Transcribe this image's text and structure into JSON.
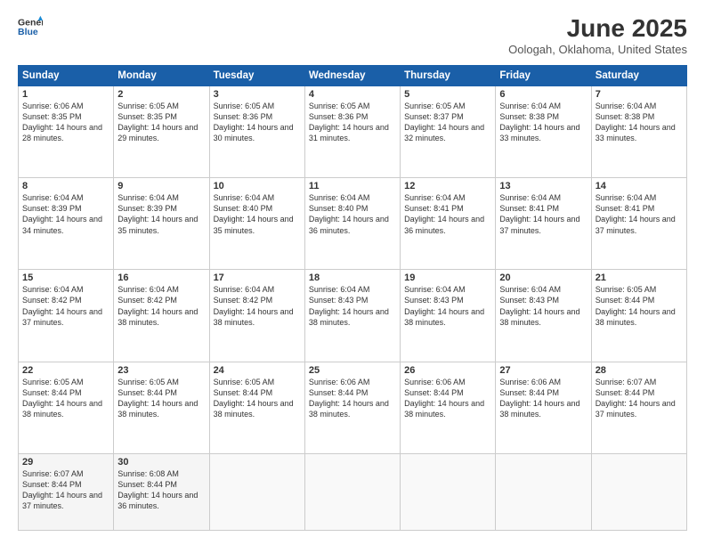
{
  "header": {
    "logo_line1": "General",
    "logo_line2": "Blue",
    "month": "June 2025",
    "location": "Oologah, Oklahoma, United States"
  },
  "days_of_week": [
    "Sunday",
    "Monday",
    "Tuesday",
    "Wednesday",
    "Thursday",
    "Friday",
    "Saturday"
  ],
  "weeks": [
    [
      {
        "day": "1",
        "sunrise": "Sunrise: 6:06 AM",
        "sunset": "Sunset: 8:35 PM",
        "daylight": "Daylight: 14 hours and 28 minutes."
      },
      {
        "day": "2",
        "sunrise": "Sunrise: 6:05 AM",
        "sunset": "Sunset: 8:35 PM",
        "daylight": "Daylight: 14 hours and 29 minutes."
      },
      {
        "day": "3",
        "sunrise": "Sunrise: 6:05 AM",
        "sunset": "Sunset: 8:36 PM",
        "daylight": "Daylight: 14 hours and 30 minutes."
      },
      {
        "day": "4",
        "sunrise": "Sunrise: 6:05 AM",
        "sunset": "Sunset: 8:36 PM",
        "daylight": "Daylight: 14 hours and 31 minutes."
      },
      {
        "day": "5",
        "sunrise": "Sunrise: 6:05 AM",
        "sunset": "Sunset: 8:37 PM",
        "daylight": "Daylight: 14 hours and 32 minutes."
      },
      {
        "day": "6",
        "sunrise": "Sunrise: 6:04 AM",
        "sunset": "Sunset: 8:38 PM",
        "daylight": "Daylight: 14 hours and 33 minutes."
      },
      {
        "day": "7",
        "sunrise": "Sunrise: 6:04 AM",
        "sunset": "Sunset: 8:38 PM",
        "daylight": "Daylight: 14 hours and 33 minutes."
      }
    ],
    [
      {
        "day": "8",
        "sunrise": "Sunrise: 6:04 AM",
        "sunset": "Sunset: 8:39 PM",
        "daylight": "Daylight: 14 hours and 34 minutes."
      },
      {
        "day": "9",
        "sunrise": "Sunrise: 6:04 AM",
        "sunset": "Sunset: 8:39 PM",
        "daylight": "Daylight: 14 hours and 35 minutes."
      },
      {
        "day": "10",
        "sunrise": "Sunrise: 6:04 AM",
        "sunset": "Sunset: 8:40 PM",
        "daylight": "Daylight: 14 hours and 35 minutes."
      },
      {
        "day": "11",
        "sunrise": "Sunrise: 6:04 AM",
        "sunset": "Sunset: 8:40 PM",
        "daylight": "Daylight: 14 hours and 36 minutes."
      },
      {
        "day": "12",
        "sunrise": "Sunrise: 6:04 AM",
        "sunset": "Sunset: 8:41 PM",
        "daylight": "Daylight: 14 hours and 36 minutes."
      },
      {
        "day": "13",
        "sunrise": "Sunrise: 6:04 AM",
        "sunset": "Sunset: 8:41 PM",
        "daylight": "Daylight: 14 hours and 37 minutes."
      },
      {
        "day": "14",
        "sunrise": "Sunrise: 6:04 AM",
        "sunset": "Sunset: 8:41 PM",
        "daylight": "Daylight: 14 hours and 37 minutes."
      }
    ],
    [
      {
        "day": "15",
        "sunrise": "Sunrise: 6:04 AM",
        "sunset": "Sunset: 8:42 PM",
        "daylight": "Daylight: 14 hours and 37 minutes."
      },
      {
        "day": "16",
        "sunrise": "Sunrise: 6:04 AM",
        "sunset": "Sunset: 8:42 PM",
        "daylight": "Daylight: 14 hours and 38 minutes."
      },
      {
        "day": "17",
        "sunrise": "Sunrise: 6:04 AM",
        "sunset": "Sunset: 8:42 PM",
        "daylight": "Daylight: 14 hours and 38 minutes."
      },
      {
        "day": "18",
        "sunrise": "Sunrise: 6:04 AM",
        "sunset": "Sunset: 8:43 PM",
        "daylight": "Daylight: 14 hours and 38 minutes."
      },
      {
        "day": "19",
        "sunrise": "Sunrise: 6:04 AM",
        "sunset": "Sunset: 8:43 PM",
        "daylight": "Daylight: 14 hours and 38 minutes."
      },
      {
        "day": "20",
        "sunrise": "Sunrise: 6:04 AM",
        "sunset": "Sunset: 8:43 PM",
        "daylight": "Daylight: 14 hours and 38 minutes."
      },
      {
        "day": "21",
        "sunrise": "Sunrise: 6:05 AM",
        "sunset": "Sunset: 8:44 PM",
        "daylight": "Daylight: 14 hours and 38 minutes."
      }
    ],
    [
      {
        "day": "22",
        "sunrise": "Sunrise: 6:05 AM",
        "sunset": "Sunset: 8:44 PM",
        "daylight": "Daylight: 14 hours and 38 minutes."
      },
      {
        "day": "23",
        "sunrise": "Sunrise: 6:05 AM",
        "sunset": "Sunset: 8:44 PM",
        "daylight": "Daylight: 14 hours and 38 minutes."
      },
      {
        "day": "24",
        "sunrise": "Sunrise: 6:05 AM",
        "sunset": "Sunset: 8:44 PM",
        "daylight": "Daylight: 14 hours and 38 minutes."
      },
      {
        "day": "25",
        "sunrise": "Sunrise: 6:06 AM",
        "sunset": "Sunset: 8:44 PM",
        "daylight": "Daylight: 14 hours and 38 minutes."
      },
      {
        "day": "26",
        "sunrise": "Sunrise: 6:06 AM",
        "sunset": "Sunset: 8:44 PM",
        "daylight": "Daylight: 14 hours and 38 minutes."
      },
      {
        "day": "27",
        "sunrise": "Sunrise: 6:06 AM",
        "sunset": "Sunset: 8:44 PM",
        "daylight": "Daylight: 14 hours and 38 minutes."
      },
      {
        "day": "28",
        "sunrise": "Sunrise: 6:07 AM",
        "sunset": "Sunset: 8:44 PM",
        "daylight": "Daylight: 14 hours and 37 minutes."
      }
    ],
    [
      {
        "day": "29",
        "sunrise": "Sunrise: 6:07 AM",
        "sunset": "Sunset: 8:44 PM",
        "daylight": "Daylight: 14 hours and 37 minutes."
      },
      {
        "day": "30",
        "sunrise": "Sunrise: 6:08 AM",
        "sunset": "Sunset: 8:44 PM",
        "daylight": "Daylight: 14 hours and 36 minutes."
      },
      {
        "day": "",
        "sunrise": "",
        "sunset": "",
        "daylight": ""
      },
      {
        "day": "",
        "sunrise": "",
        "sunset": "",
        "daylight": ""
      },
      {
        "day": "",
        "sunrise": "",
        "sunset": "",
        "daylight": ""
      },
      {
        "day": "",
        "sunrise": "",
        "sunset": "",
        "daylight": ""
      },
      {
        "day": "",
        "sunrise": "",
        "sunset": "",
        "daylight": ""
      }
    ]
  ]
}
